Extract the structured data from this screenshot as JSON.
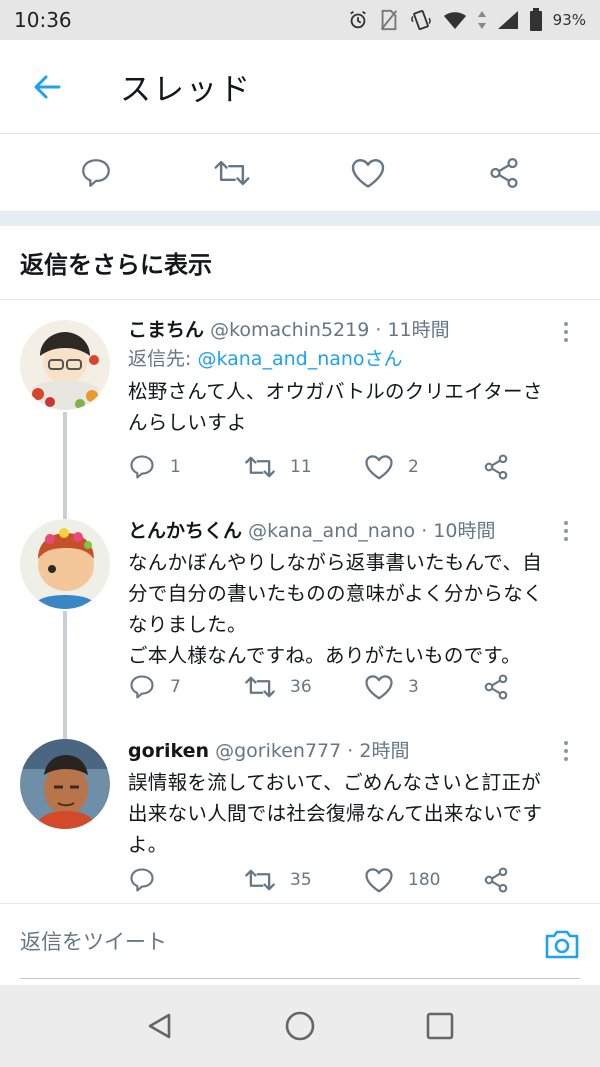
{
  "status_bar": {
    "time": "10:36",
    "battery": "93%",
    "icons": [
      "alarm-icon",
      "no-sim-icon",
      "vibrate-icon",
      "wifi-icon",
      "data-arrows-icon",
      "signal-icon",
      "battery-icon"
    ]
  },
  "header": {
    "title": "スレッド",
    "back_icon": "back-arrow-icon"
  },
  "action_bar": {
    "icons": [
      "reply-icon",
      "retweet-icon",
      "like-icon",
      "share-icon"
    ]
  },
  "more_replies_label": "返信をさらに表示",
  "tweets": [
    {
      "name": "こまちん",
      "handle": "@komachin5219",
      "time": "· 11時間",
      "reply_label": "返信先: ",
      "reply_to": "@kana_and_nanoさん",
      "text_lines": [
        "松野さんて人、オウガバトルのクリエイターさ",
        "んらしいすよ"
      ],
      "replies": "1",
      "retweets": "11",
      "likes": "2"
    },
    {
      "name": "とんかちくん",
      "handle": "@kana_and_nano",
      "time": "· 10時間",
      "text_lines": [
        "なんかぼんやりしながら返事書いたもんで、自",
        "分で自分の書いたものの意味がよく分からなく",
        "なりました。",
        "ご本人様なんですね。ありがたいものです。"
      ],
      "replies": "7",
      "retweets": "36",
      "likes": "3"
    },
    {
      "name": "goriken",
      "handle": "@goriken777",
      "time": "· 2時間",
      "text_lines": [
        "誤情報を流しておいて、ごめんなさいと訂正が",
        "出来ない人間では社会復帰なんて出来ないです",
        "よ。"
      ],
      "replies": "",
      "retweets": "35",
      "likes": "180"
    }
  ],
  "composer": {
    "placeholder": "返信をツイート",
    "camera_icon": "camera-icon"
  },
  "nav_bar": {
    "icons": [
      "nav-back-icon",
      "nav-home-icon",
      "nav-recents-icon"
    ]
  },
  "colors": {
    "accent": "#1da1f2",
    "secondary_text": "#657786",
    "icon_gray": "#657786"
  }
}
